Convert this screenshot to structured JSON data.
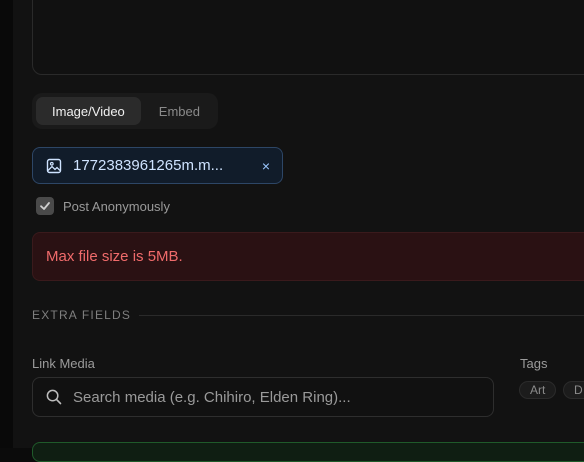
{
  "tabs": [
    {
      "label": "Image/Video",
      "active": true
    },
    {
      "label": "Embed",
      "active": false
    }
  ],
  "attachment": {
    "filename": "1772383961265m.m...",
    "remove_icon": "×"
  },
  "options": {
    "anonymous_label": "Post Anonymously",
    "anonymous_checked": true
  },
  "error": {
    "message": "Max file size is 5MB."
  },
  "extra_fields": {
    "title": "EXTRA FIELDS",
    "link_media_label": "Link Media",
    "search_placeholder": "Search media (e.g. Chihiro, Elden Ring)...",
    "tags_label": "Tags",
    "tags": [
      "Art",
      "D"
    ]
  },
  "colors": {
    "accent_blue": "#9cc8ff",
    "error_red": "#f06b6b",
    "success_green": "#1f5a2a"
  }
}
